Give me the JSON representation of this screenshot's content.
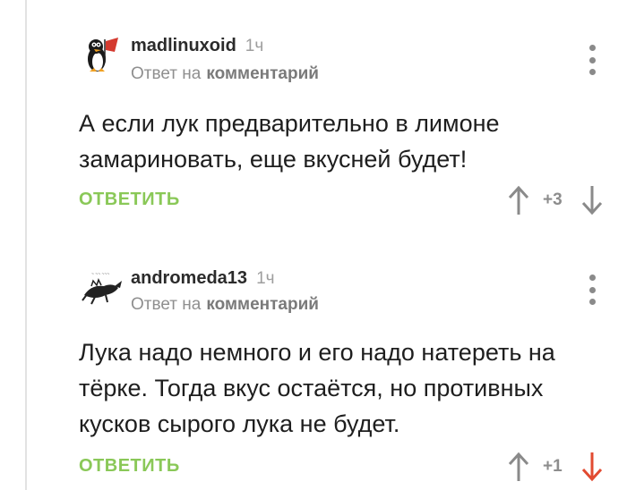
{
  "comments": [
    {
      "author": "madlinuxoid",
      "time": "1ч",
      "reply_prefix": "Ответ на",
      "reply_link": "комментарий",
      "text": "А если лук предварительно в лимоне замариновать, еще вкусней будет!",
      "reply_button": "ОТВЕТИТЬ",
      "rating": "+3",
      "downvote_color": "#8a8a8a",
      "avatar_icon": "penguin-avatar"
    },
    {
      "author": "andromeda13",
      "time": "1ч",
      "reply_prefix": "Ответ на",
      "reply_link": "комментарий",
      "text": "Лука надо немного и его надо натереть на тёрке. Тогда вкус остаётся, но противных кусков сырого лука не будет.",
      "reply_button": "ОТВЕТИТЬ",
      "rating": "+1",
      "downvote_color": "#e24b31",
      "avatar_icon": "dragon-sketch-avatar"
    }
  ],
  "colors": {
    "accent_green": "#8ac858",
    "downvote_active": "#e24b31",
    "muted": "#8a8a8a"
  }
}
